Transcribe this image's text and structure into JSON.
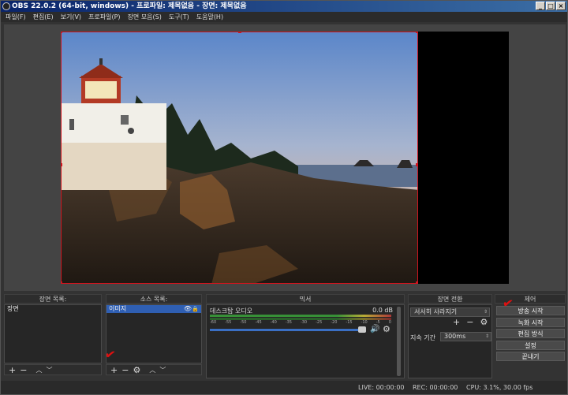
{
  "titlebar": {
    "title": "OBS 22.0.2 (64-bit, windows) - 프로파일: 제목없음 - 장면: 제목없음",
    "minimize": "_",
    "maximize": "□",
    "close": "×"
  },
  "menu": [
    "파일(F)",
    "편집(E)",
    "보기(V)",
    "프로파일(P)",
    "장면 모음(S)",
    "도구(T)",
    "도움말(H)"
  ],
  "scenes": {
    "label": "장면 목록:",
    "items": [
      "장면"
    ],
    "add": "+",
    "remove": "−",
    "up": "︿",
    "down": "﹀"
  },
  "sources": {
    "label": "소스 목록:",
    "items": [
      "이미지"
    ],
    "add": "+",
    "remove": "−",
    "settings": "⚙",
    "up": "︿",
    "down": "﹀",
    "visible_icon": "eye-icon",
    "lock_icon": "lock-icon"
  },
  "mixer": {
    "label": "믹서",
    "track": {
      "name": "데스크탑 오디오",
      "level": "0.0 dB",
      "volume": 0.92
    },
    "scale": [
      "-60",
      "-55",
      "-50",
      "-45",
      "-40",
      "-35",
      "-30",
      "-25",
      "-20",
      "-15",
      "-10",
      "-5",
      "0"
    ]
  },
  "transitions": {
    "label": "장면 전환",
    "selected": "서서히 사라지기",
    "add": "+",
    "remove": "−",
    "settings": "⚙",
    "duration_label": "지속 기간",
    "duration": "300ms"
  },
  "controls": {
    "label": "제어",
    "buttons": [
      "방송 시작",
      "녹화 시작",
      "편집 방식",
      "설정",
      "끝내기"
    ]
  },
  "status": {
    "live": "LIVE: 00:00:00",
    "rec": "REC: 00:00:00",
    "cpu": "CPU: 3.1%, 30.00 fps"
  },
  "colors": {
    "accent": "#2f5fb3",
    "bounding_box": "#d0141e",
    "annotation": "#e01010"
  }
}
